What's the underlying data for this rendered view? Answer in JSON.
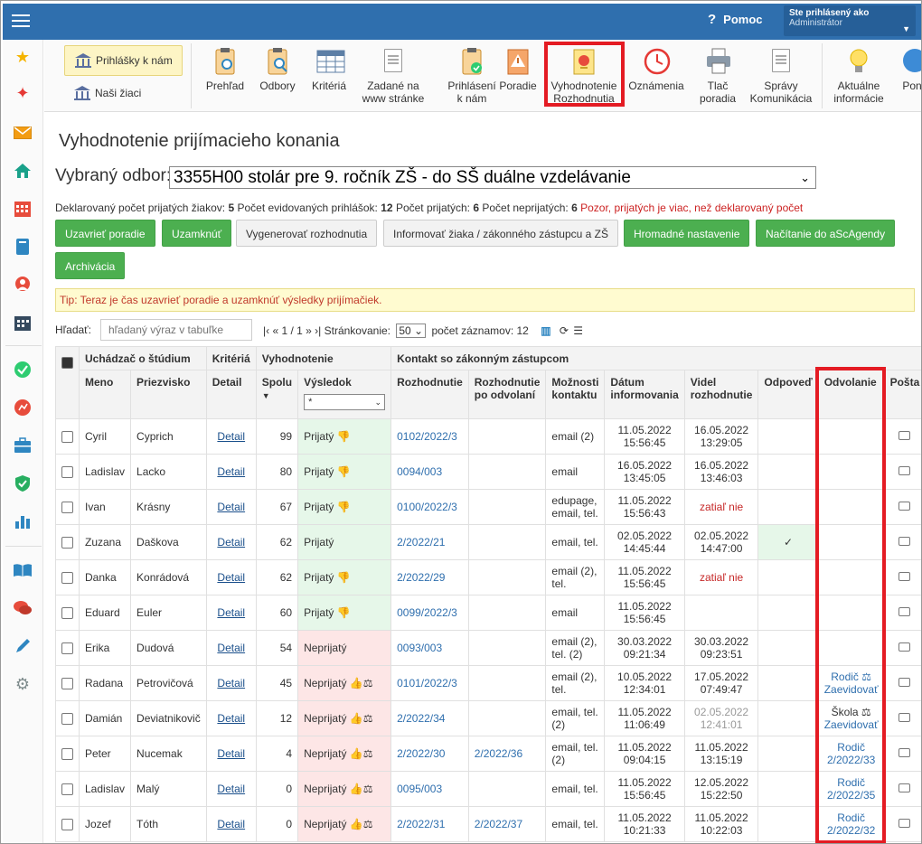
{
  "topbar": {
    "help_label": "Pomoc",
    "user_line1": "Ste prihlásený ako",
    "user_line2": "Administrátor"
  },
  "toolbar": {
    "btn_prihlasky": "Prihlášky k nám",
    "btn_ziaci": "Naši žiaci",
    "tools": [
      {
        "id": "prehlad",
        "line1": "Prehľad",
        "line2": ""
      },
      {
        "id": "odbory",
        "line1": "Odbory",
        "line2": ""
      },
      {
        "id": "kriteria",
        "line1": "Kritériá",
        "line2": ""
      },
      {
        "id": "zadane",
        "line1": "Zadané na",
        "line2": "www stránke"
      },
      {
        "id": "prihlaseni",
        "line1": "Prihlásení",
        "line2": "k nám"
      },
      {
        "id": "poradie",
        "line1": "Poradie",
        "line2": ""
      },
      {
        "id": "vyhodnotenie",
        "line1": "Vyhodnotenie",
        "line2": "Rozhodnutia"
      },
      {
        "id": "oznamenia",
        "line1": "Oznámenia",
        "line2": ""
      },
      {
        "id": "tlac",
        "line1": "Tlač",
        "line2": "poradia"
      },
      {
        "id": "spravy",
        "line1": "Správy",
        "line2": "Komunikácia"
      },
      {
        "id": "aktualne",
        "line1": "Aktuálne",
        "line2": "informácie"
      },
      {
        "id": "pomoc",
        "line1": "Pon",
        "line2": ""
      }
    ]
  },
  "page": {
    "title": "Vyhodnotenie prijímacieho konania",
    "field_label": "Vybraný odbor:",
    "field_value": "3355H00 stolár pre 9. ročník ZŠ - do SŠ duálne vzdelávanie",
    "stats": {
      "declared_label": "Deklarovaný počet prijatých žiakov:",
      "declared": "5",
      "registered_label": "Počet evidovaných prihlášok:",
      "registered": "12",
      "accepted_label": "Počet prijatých:",
      "accepted": "6",
      "rejected_label": "Počet neprijatých:",
      "rejected": "6",
      "warning": "Pozor, prijatých je viac, než deklarovaný počet"
    },
    "buttons": {
      "uzavriet": "Uzavrieť poradie",
      "uzamknut": "Uzamknúť",
      "vygenerovat": "Vygenerovať rozhodnutia",
      "informovat": "Informovať žiaka / zákonného zástupcu a ZŠ",
      "hromadne": "Hromadné nastavenie",
      "nacitanie": "Načítanie do aScAgendy",
      "archivacia": "Archivácia"
    },
    "tip": "Tip: Teraz je čas uzavrieť poradie a uzamknúť výsledky prijímačiek.",
    "search_label": "Hľadať:",
    "search_placeholder": "hľadaný výraz v tabuľke",
    "pager_text": "|‹ « 1 / 1 » ›|",
    "per_page_label": "Stránkovanie:",
    "per_page": "50",
    "records_label": "počet záznamov: 12"
  },
  "table": {
    "group_headers": {
      "uchadzac": "Uchádzač o štúdium",
      "kriteria": "Kritériá",
      "vyhodnotenie": "Vyhodnotenie",
      "kontakt": "Kontakt so zákonným zástupcom"
    },
    "headers": {
      "meno": "Meno",
      "priezvisko": "Priezvisko",
      "detail": "Detail",
      "spolu": "Spolu",
      "vysledok": "Výsledok",
      "rozhodnutie": "Rozhodnutie",
      "po_odvolani": "Rozhodnutie po odvolaní",
      "moznosti": "Možnosti kontaktu",
      "datum": "Dátum informovania",
      "videl": "Videl rozhodnutie",
      "odpoved": "Odpoveď",
      "odvolanie": "Odvolanie",
      "posta": "Pošta"
    },
    "filter_value": "*",
    "rows": [
      {
        "meno": "Cyril",
        "priezvisko": "Cyprich",
        "detail": "Detail",
        "spolu": "99",
        "vysledok": "Prijatý 👎",
        "status": "acc",
        "rozh": "0102/2022/3",
        "poodv": "",
        "kontakt": "email (2)",
        "datum": "11.05.2022 15:56:45",
        "videl": "16.05.2022 13:29:05",
        "videl_style": "",
        "odpoved": "",
        "odvolanie": "",
        "odv_style": ""
      },
      {
        "meno": "Ladislav",
        "priezvisko": "Lacko",
        "detail": "Detail",
        "spolu": "80",
        "vysledok": "Prijatý 👎",
        "status": "acc",
        "rozh": "0094/003",
        "poodv": "",
        "kontakt": "email",
        "datum": "16.05.2022 13:45:05",
        "videl": "16.05.2022 13:46:03",
        "videl_style": "",
        "odpoved": "",
        "odvolanie": "",
        "odv_style": ""
      },
      {
        "meno": "Ivan",
        "priezvisko": "Krásny",
        "detail": "Detail",
        "spolu": "67",
        "vysledok": "Prijatý 👎",
        "status": "acc",
        "rozh": "0100/2022/3",
        "poodv": "",
        "kontakt": "edupage, email, tel.",
        "datum": "11.05.2022 15:56:43",
        "videl": "zatiaľ nie",
        "videl_style": "red",
        "odpoved": "",
        "odvolanie": "",
        "odv_style": ""
      },
      {
        "meno": "Zuzana",
        "priezvisko": "Daškova",
        "detail": "Detail",
        "spolu": "62",
        "vysledok": "Prijatý",
        "status": "acc",
        "rozh": "2/2022/21",
        "poodv": "",
        "kontakt": "email, tel.",
        "datum": "02.05.2022 14:45:44",
        "videl": "02.05.2022 14:47:00",
        "videl_style": "",
        "odpoved": "✓",
        "odvolanie": "",
        "odv_style": ""
      },
      {
        "meno": "Danka",
        "priezvisko": "Konrádová",
        "detail": "Detail",
        "spolu": "62",
        "vysledok": "Prijatý 👎",
        "status": "acc",
        "rozh": "2/2022/29",
        "poodv": "",
        "kontakt": "email (2), tel.",
        "datum": "11.05.2022 15:56:45",
        "videl": "zatiaľ nie",
        "videl_style": "red",
        "odpoved": "",
        "odvolanie": "",
        "odv_style": ""
      },
      {
        "meno": "Eduard",
        "priezvisko": "Euler",
        "detail": "Detail",
        "spolu": "60",
        "vysledok": "Prijatý 👎",
        "status": "acc",
        "rozh": "0099/2022/3",
        "poodv": "",
        "kontakt": "email",
        "datum": "11.05.2022 15:56:45",
        "videl": "",
        "videl_style": "",
        "odpoved": "",
        "odvolanie": "",
        "odv_style": ""
      },
      {
        "meno": "Erika",
        "priezvisko": "Dudová",
        "detail": "Detail",
        "spolu": "54",
        "vysledok": "Neprijatý",
        "status": "rej",
        "rozh": "0093/003",
        "poodv": "",
        "kontakt": "email (2), tel. (2)",
        "datum": "30.03.2022 09:21:34",
        "videl": "30.03.2022 09:23:51",
        "videl_style": "",
        "odpoved": "",
        "odvolanie": "",
        "odv_style": ""
      },
      {
        "meno": "Radana",
        "priezvisko": "Petrovičová",
        "detail": "Detail",
        "spolu": "45",
        "vysledok": "Neprijatý 👍⚖",
        "status": "rej",
        "rozh": "0101/2022/3",
        "poodv": "",
        "kontakt": "email (2), tel.",
        "datum": "10.05.2022 12:34:01",
        "videl": "17.05.2022 07:49:47",
        "videl_style": "",
        "odpoved": "",
        "odvolanie": "Rodič ⚖ Zaevidovať",
        "odv_style": "lnk"
      },
      {
        "meno": "Damián",
        "priezvisko": "Deviatnikovič",
        "detail": "Detail",
        "spolu": "12",
        "vysledok": "Neprijatý 👍⚖",
        "status": "rej",
        "rozh": "2/2022/34",
        "poodv": "",
        "kontakt": "email, tel. (2)",
        "datum": "11.05.2022 11:06:49",
        "videl": "02.05.2022 12:41:01",
        "videl_style": "gray",
        "odpoved": "",
        "odvolanie": "Škola ⚖ Zaevidovať",
        "odv_style": "mix"
      },
      {
        "meno": "Peter",
        "priezvisko": "Nucemak",
        "detail": "Detail",
        "spolu": "4",
        "vysledok": "Neprijatý 👍⚖",
        "status": "rej",
        "rozh": "2/2022/30",
        "poodv": "2/2022/36",
        "kontakt": "email, tel. (2)",
        "datum": "11.05.2022 09:04:15",
        "videl": "11.05.2022 13:15:19",
        "videl_style": "",
        "odpoved": "",
        "odvolanie": "Rodič 2/2022/33",
        "odv_style": "lnk"
      },
      {
        "meno": "Ladislav",
        "priezvisko": "Malý",
        "detail": "Detail",
        "spolu": "0",
        "vysledok": "Neprijatý 👍⚖",
        "status": "rej",
        "rozh": "0095/003",
        "poodv": "",
        "kontakt": "email, tel.",
        "datum": "11.05.2022 15:56:45",
        "videl": "12.05.2022 15:22:50",
        "videl_style": "",
        "odpoved": "",
        "odvolanie": "Rodič 2/2022/35",
        "odv_style": "lnk"
      },
      {
        "meno": "Jozef",
        "priezvisko": "Tóth",
        "detail": "Detail",
        "spolu": "0",
        "vysledok": "Neprijatý 👍⚖",
        "status": "rej",
        "rozh": "2/2022/31",
        "poodv": "2/2022/37",
        "kontakt": "email, tel.",
        "datum": "11.05.2022 10:21:33",
        "videl": "11.05.2022 10:22:03",
        "videl_style": "",
        "odpoved": "",
        "odvolanie": "Rodič 2/2022/32",
        "odv_style": "lnk"
      }
    ]
  },
  "colors": {
    "topbar": "#2f6fae",
    "green_button": "#4caf50",
    "accepted_bg": "#e6f7e9",
    "rejected_bg": "#fde6e6",
    "highlight": "#e41b23",
    "link": "#2f6fae"
  },
  "sidebar_icons": [
    "star-icon",
    "magic-wand-icon",
    "mail-icon",
    "home-icon",
    "calendar-icon",
    "notebook-icon",
    "user-icon",
    "timetable-icon",
    "check-circle-icon",
    "chart-pie-icon",
    "briefcase-icon",
    "shield-icon",
    "bar-chart-icon",
    "book-icon",
    "chat-icon",
    "pen-icon",
    "gear-icon"
  ]
}
